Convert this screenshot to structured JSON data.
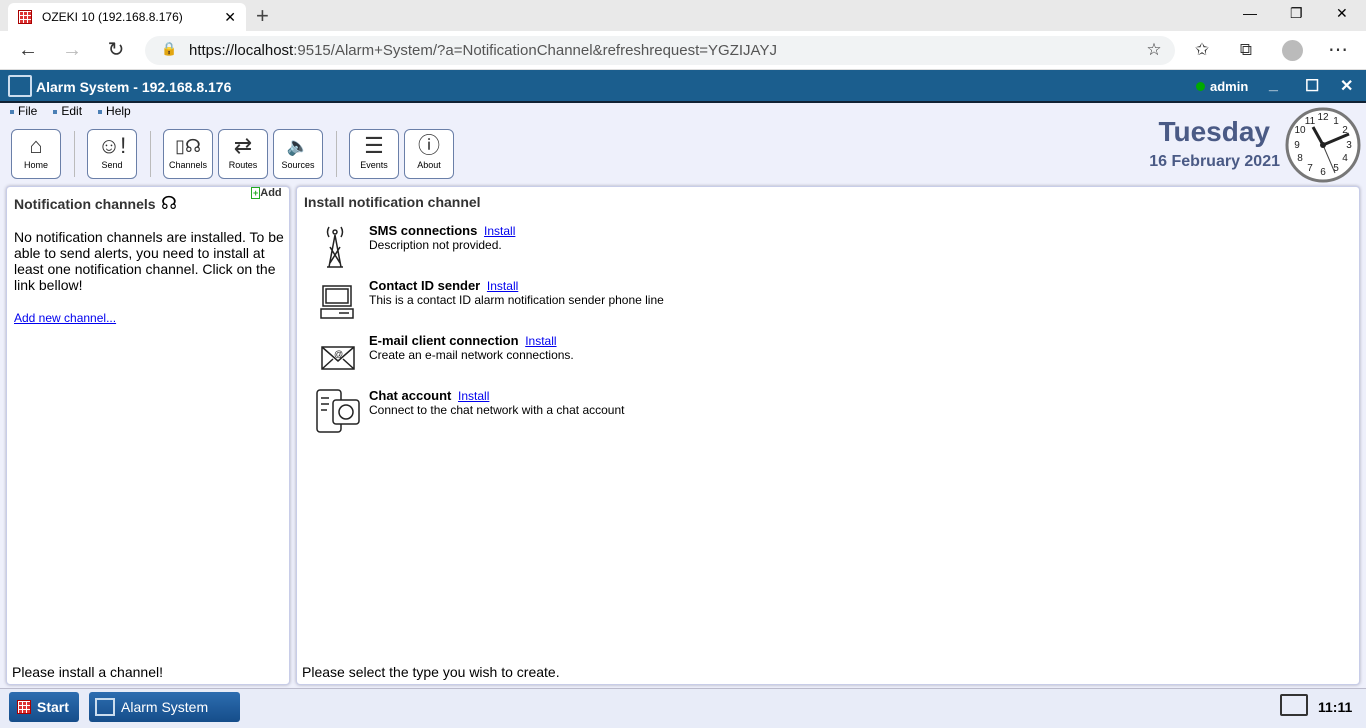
{
  "browser": {
    "tab_title": "OZEKI 10 (192.168.8.176)",
    "url_host": "https://localhost",
    "url_rest": ":9515/Alarm+System/?a=NotificationChannel&refreshrequest=YGZIJAYJ"
  },
  "app": {
    "title": "Alarm System - 192.168.8.176",
    "user": "admin",
    "user_status_color": "#00a000"
  },
  "menu": [
    "File",
    "Edit",
    "Help"
  ],
  "toolbar": [
    {
      "label": "Home",
      "icon": "home-icon"
    },
    {
      "label": "Send",
      "icon": "send-alert-icon"
    },
    {
      "label": "Channels",
      "icon": "channels-icon"
    },
    {
      "label": "Routes",
      "icon": "routes-icon"
    },
    {
      "label": "Sources",
      "icon": "speaker-icon"
    },
    {
      "label": "Events",
      "icon": "events-icon"
    },
    {
      "label": "About",
      "icon": "info-icon"
    }
  ],
  "datetime": {
    "day": "Tuesday",
    "date": "16 February 2021",
    "clock_time": "11:11"
  },
  "left_panel": {
    "title": "Notification channels",
    "add_label": "Add",
    "message": "No notification channels are installed. To be able to send alerts, you need to install at least one notification channel. Click on the link bellow!",
    "link": "Add new channel...",
    "footer": "Please install a channel!"
  },
  "right_panel": {
    "title": "Install notification channel",
    "footer": "Please select the type you wish to create.",
    "install_label": "Install",
    "items": [
      {
        "name": "SMS connections",
        "desc": "Description not provided.",
        "icon": "cell-tower-icon"
      },
      {
        "name": "Contact ID sender",
        "desc": "This is a contact ID alarm notification sender phone line",
        "icon": "computer-icon"
      },
      {
        "name": "E-mail client connection",
        "desc": "Create an e-mail network connections.",
        "icon": "email-icon"
      },
      {
        "name": "Chat account",
        "desc": "Connect to the chat network with a chat account",
        "icon": "chat-icon"
      }
    ]
  },
  "taskbar": {
    "start": "Start",
    "task": "Alarm System",
    "time": "11:11"
  }
}
